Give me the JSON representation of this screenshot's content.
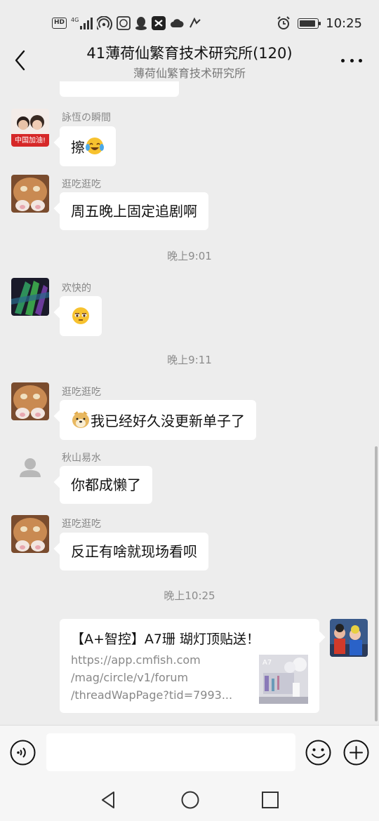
{
  "status_bar": {
    "hd": "HD",
    "network": "4G",
    "time": "10:25",
    "icons": [
      "hd-icon",
      "signal-icon",
      "hotspot-icon",
      "app-icon",
      "qq-icon",
      "capcut-icon",
      "cloud-icon",
      "app-icon",
      "alarm-icon",
      "battery-icon"
    ],
    "battery_level": 0.9
  },
  "header": {
    "title": "41薄荷仙繁育技术研究所(120)",
    "subtitle": "薄荷仙繁育技术研究所"
  },
  "messages": [
    {
      "sender": "詠恆の瞬間",
      "text": "擦",
      "emoji": "laughing-crying-emoji"
    },
    {
      "sender": "逛吃逛吃",
      "text": "周五晚上固定追剧啊"
    },
    {
      "timestamp": "晚上9:01"
    },
    {
      "sender": "欢快的",
      "text": "",
      "emoji": "sleepy-emoji"
    },
    {
      "timestamp": "晚上9:11"
    },
    {
      "sender": "逛吃逛吃",
      "text": "我已经好久没更新单子了",
      "emoji": "doge-emoji"
    },
    {
      "sender": "秋山易水",
      "text": "你都成懒了"
    },
    {
      "sender": "逛吃逛吃",
      "text": "反正有啥就现场看呗"
    },
    {
      "timestamp": "晚上10:25"
    }
  ],
  "link_card": {
    "title": "【A+智控】A7珊 瑚灯顶贴送！",
    "desc_lines": [
      "https://app.cmfish.com",
      "/mag/circle/v1/forum",
      "/threadWapPage?tid=7993..."
    ],
    "thumb_label": "A7"
  },
  "input_bar": {
    "placeholder": ""
  },
  "colors": {
    "background": "#ededed",
    "bubble": "#ffffff",
    "timestamp": "#8c8c8c",
    "sender": "#888888"
  }
}
